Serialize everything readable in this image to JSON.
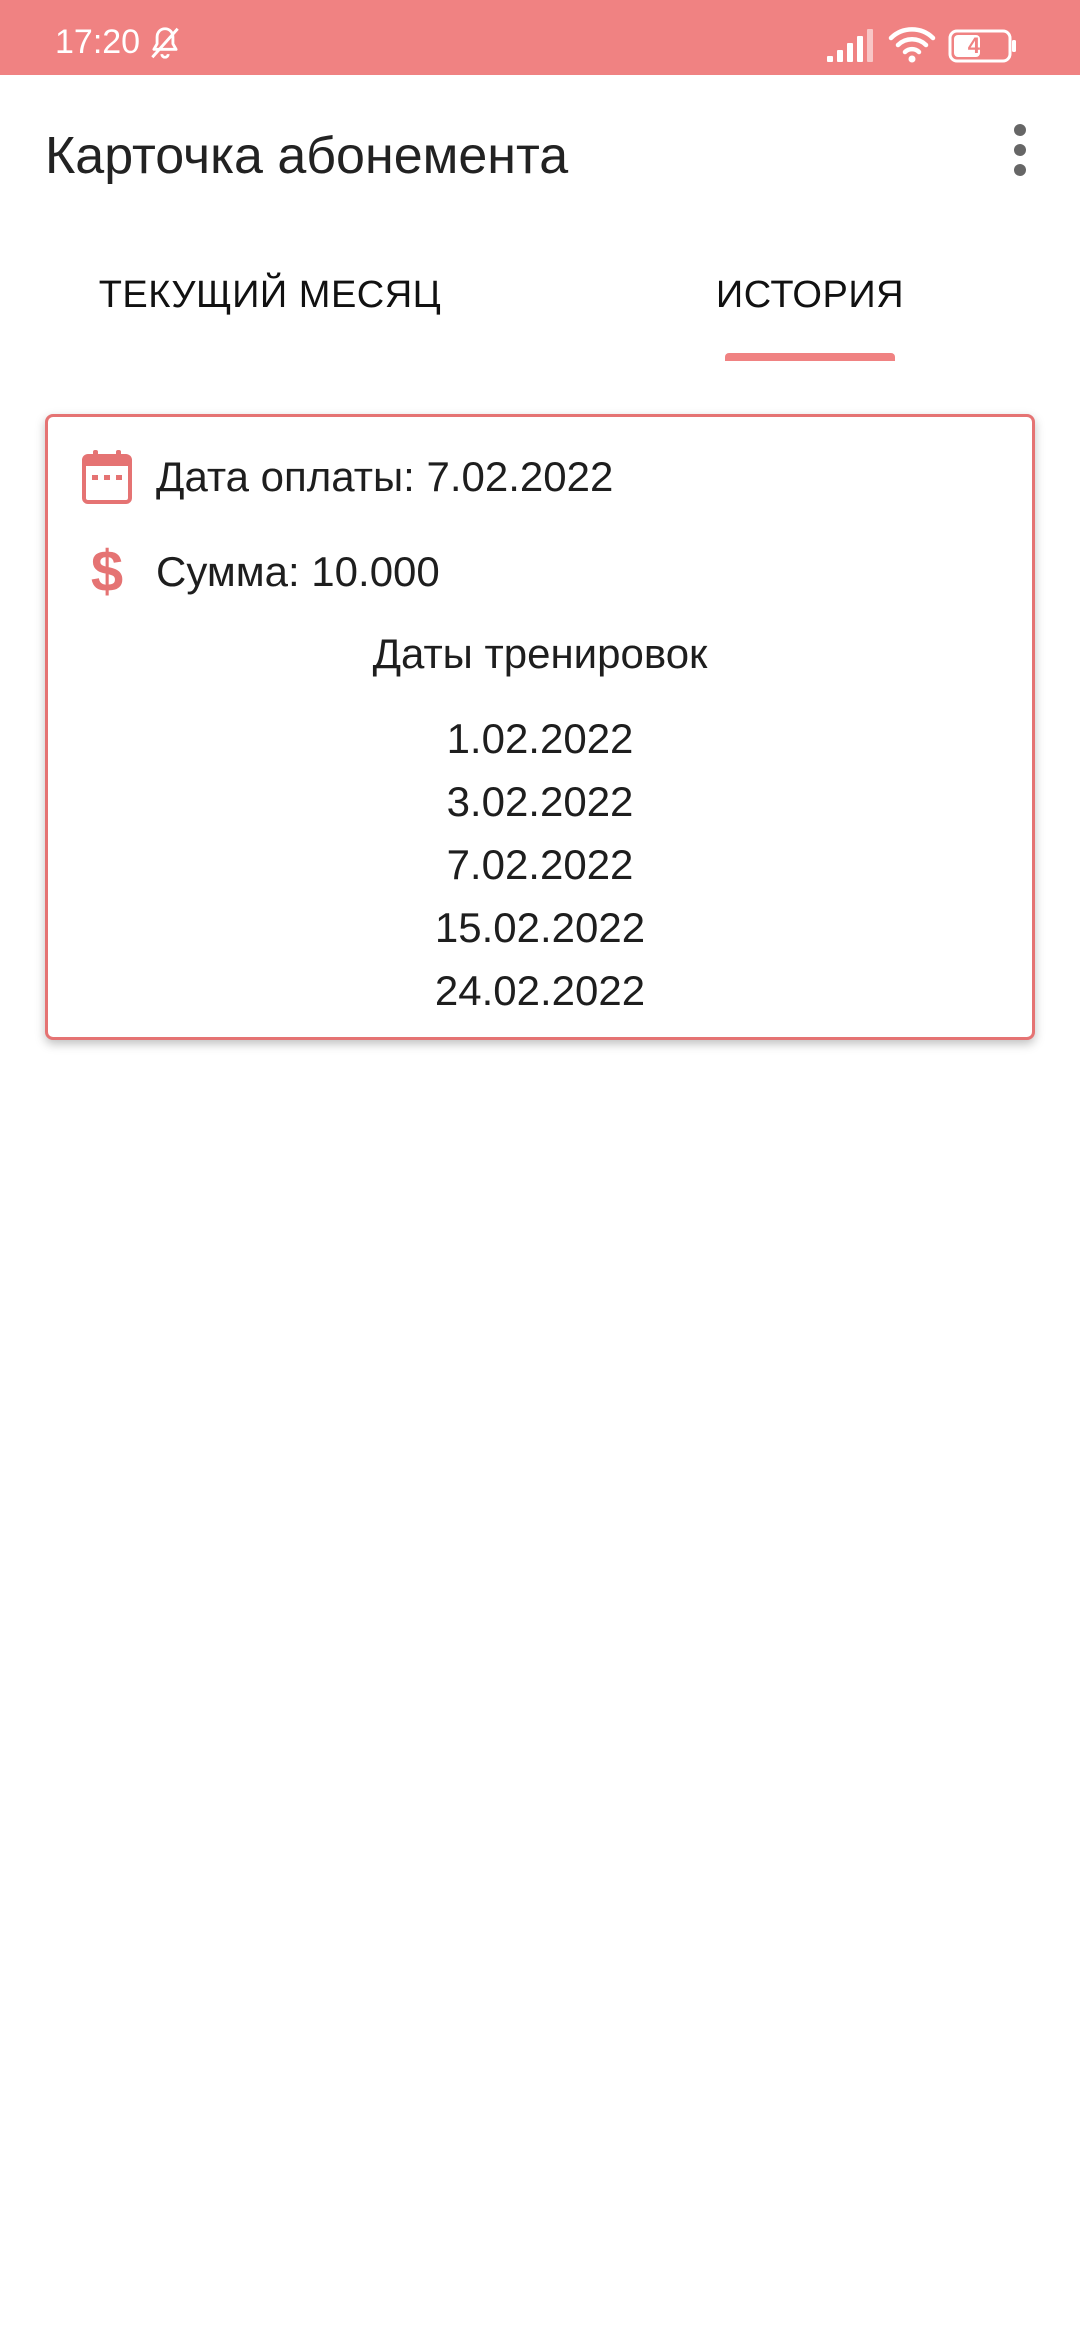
{
  "status_bar": {
    "time": "17:20",
    "battery": "48",
    "icons": [
      "bell-off-icon",
      "signal-icon",
      "wifi-icon",
      "battery-icon"
    ]
  },
  "app_bar": {
    "title": "Карточка абонемента",
    "overflow_icon": "more-vertical-icon"
  },
  "tabs": [
    {
      "label": "ТЕКУЩИЙ МЕСЯЦ",
      "selected": false
    },
    {
      "label": "ИСТОРИЯ",
      "selected": true
    }
  ],
  "colors": {
    "accent": "#f08282",
    "card_border": "#e57373"
  },
  "card": {
    "payment_date_icon": "calendar-icon",
    "payment_date_text": "Дата оплаты: 7.02.2022",
    "sum_icon": "dollar-icon",
    "sum_text": "Сумма: 10.000",
    "workouts_title": "Даты тренировок",
    "workout_dates": [
      "1.02.2022",
      "3.02.2022",
      "7.02.2022",
      "15.02.2022",
      "24.02.2022"
    ]
  }
}
